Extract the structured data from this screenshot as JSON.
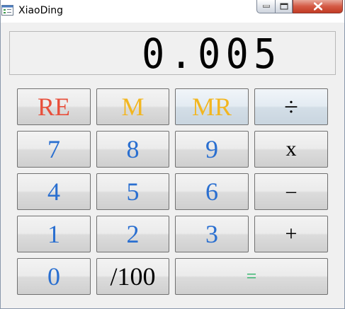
{
  "window": {
    "title": "XiaoDing",
    "icon": "app-window-icon",
    "controls": [
      "minimize",
      "maximize",
      "close"
    ]
  },
  "display": {
    "value": "0.005"
  },
  "keys": {
    "re": "RE",
    "m": "M",
    "mr": "MR",
    "divide": "÷",
    "seven": "7",
    "eight": "8",
    "nine": "9",
    "multiply": "x",
    "four": "4",
    "five": "5",
    "six": "6",
    "subtract": "–",
    "one": "1",
    "two": "2",
    "three": "3",
    "add": "+",
    "zero": "0",
    "percent": "/100",
    "equals": "="
  },
  "colors": {
    "red": "#e8503c",
    "yellow": "#f2b620",
    "blue": "#2a6fd0",
    "green": "#2fb36a"
  }
}
